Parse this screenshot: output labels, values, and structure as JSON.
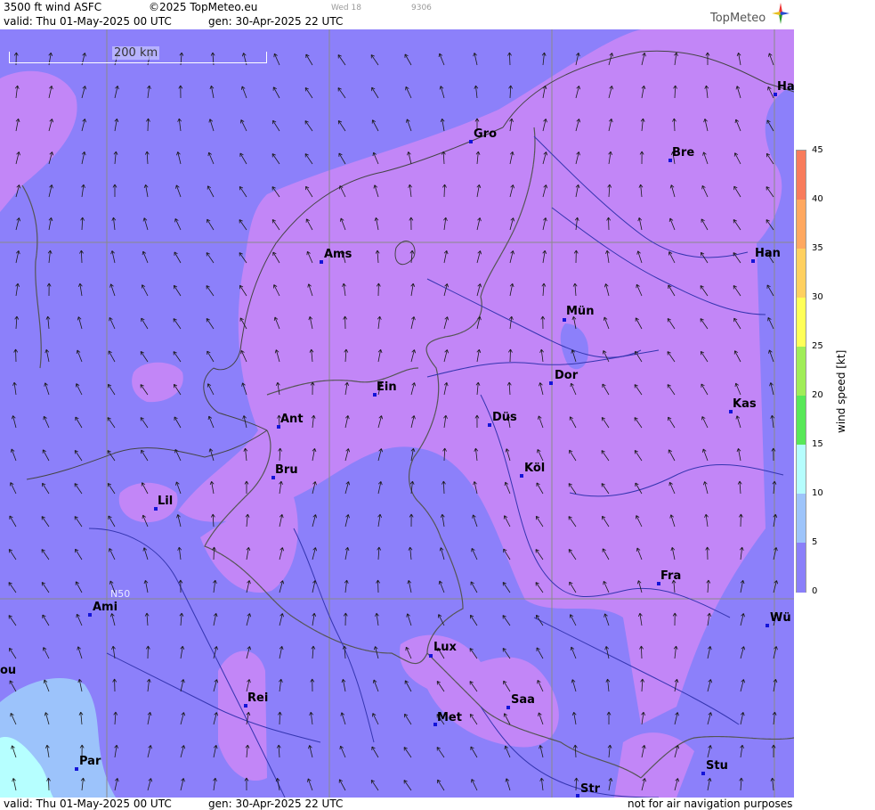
{
  "header": {
    "product": "3500 ft wind ASFC",
    "copyright": "©2025 TopMeteo.eu",
    "day_hint": "Wed 18",
    "code_hint": "9306",
    "valid": "valid:  Thu   01-May-2025   00 UTC",
    "gen": "gen: 30-Apr-2025 22 UTC",
    "logo_text": "TopMeteo",
    "logo_icon": "compass-icon"
  },
  "footer": {
    "valid": "valid:  Thu   01-May-2025   00 UTC",
    "gen": "gen: 30-Apr-2025 22 UTC",
    "disclaimer": "not for air navigation purposes"
  },
  "map": {
    "scale_label": "200 km",
    "lat_label": "N50",
    "cities": [
      {
        "name": "Gro"
      },
      {
        "name": "Bre"
      },
      {
        "name": "Ha"
      },
      {
        "name": "Ams"
      },
      {
        "name": "Han"
      },
      {
        "name": "Mün"
      },
      {
        "name": "Dor"
      },
      {
        "name": "Ein"
      },
      {
        "name": "Ant"
      },
      {
        "name": "Düs"
      },
      {
        "name": "Kas"
      },
      {
        "name": "Bru"
      },
      {
        "name": "Köl"
      },
      {
        "name": "Lil"
      },
      {
        "name": "Fra"
      },
      {
        "name": "Ami"
      },
      {
        "name": "Wü"
      },
      {
        "name": "Lux"
      },
      {
        "name": "ou"
      },
      {
        "name": "Rei"
      },
      {
        "name": "Saa"
      },
      {
        "name": "Met"
      },
      {
        "name": "Par"
      },
      {
        "name": "Stu"
      },
      {
        "name": "Str"
      }
    ],
    "wind_field_colors": {
      "calm": "#c286f7",
      "light": "#8c80fa",
      "moderate": "#9cc3fb",
      "fresh": "#b6ffff"
    }
  },
  "legend": {
    "title": "wind  speed  [kt]",
    "ticks": [
      "45",
      "40",
      "35",
      "30",
      "25",
      "20",
      "15",
      "10",
      "5",
      "0"
    ],
    "colors": [
      "#c27ef8",
      "#8a7ff9",
      "#9ec4fa",
      "#b5fdfd",
      "#58e858",
      "#a0ed58",
      "#ffff58",
      "#ffd060",
      "#ffa860",
      "#f87c5c"
    ]
  }
}
